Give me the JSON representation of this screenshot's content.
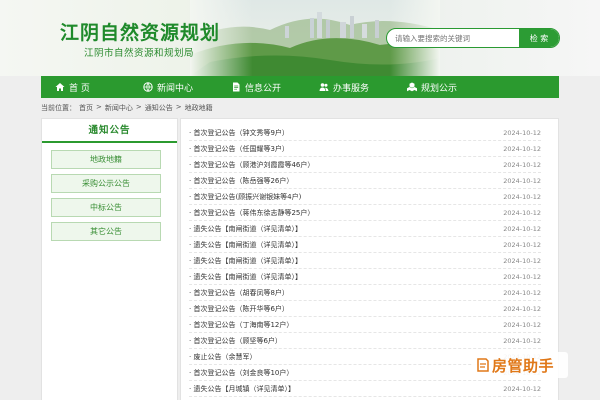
{
  "header": {
    "title": "江阴自然资源规划",
    "subtitle": "江阴市自然资源和规划局",
    "search_placeholder": "请输入要搜索的关键词",
    "search_button": "检 索"
  },
  "nav": [
    {
      "label": "首 页",
      "icon": "home-icon"
    },
    {
      "label": "新闻中心",
      "icon": "globe-icon"
    },
    {
      "label": "信息公开",
      "icon": "document-icon"
    },
    {
      "label": "办事服务",
      "icon": "people-icon"
    },
    {
      "label": "规划公示",
      "icon": "cubes-icon"
    }
  ],
  "breadcrumb": [
    "当前位置：",
    "首页",
    ">",
    "新闻中心",
    ">",
    "通知公告",
    ">",
    "地政地籍"
  ],
  "sidebar": {
    "title": "通知公告",
    "items": [
      "地政地籍",
      "采购公示公告",
      "中标公告",
      "其它公告"
    ]
  },
  "list": [
    {
      "title": "· 首次登记公告（钟文秀等9户）",
      "date": "2024-10-12"
    },
    {
      "title": "· 首次登记公告（任国耀等3户）",
      "date": "2024-10-12"
    },
    {
      "title": "· 首次登记公告（顾港沪刘霞霞等46户）",
      "date": "2024-10-12"
    },
    {
      "title": "· 首次登记公告（陈岳强等26户）",
      "date": "2024-10-12"
    },
    {
      "title": "· 首次登记公告(顾振兴谢银妹等4户)",
      "date": "2024-10-12"
    },
    {
      "title": "· 首次登记公告（蒋伟东徐志静等25户）",
      "date": "2024-10-12"
    },
    {
      "title": "· 遗失公告【南闸街道（详见清单）】",
      "date": "2024-10-12"
    },
    {
      "title": "· 遗失公告【南闸街道（详见清单）】",
      "date": "2024-10-12"
    },
    {
      "title": "· 遗失公告【南闸街道（详见清单）】",
      "date": "2024-10-12"
    },
    {
      "title": "· 遗失公告【南闸街道（详见清单）】",
      "date": "2024-10-12"
    },
    {
      "title": "· 首次登记公告（胡春凤等8户）",
      "date": "2024-10-12"
    },
    {
      "title": "· 首次登记公告（陈开华等6户）",
      "date": "2024-10-12"
    },
    {
      "title": "· 首次登记公告（丁海南等12户）",
      "date": "2024-10-12"
    },
    {
      "title": "· 首次登记公告（顾坚等6户）",
      "date": "2024-10-12"
    },
    {
      "title": "· 废止公告（余慧军）",
      "date": "2024-10-12"
    },
    {
      "title": "· 首次登记公告（刘金良等10户）",
      "date": "2024-10-12"
    },
    {
      "title": "· 遗失公告【月城镇（详见清单）】",
      "date": "2024-10-12"
    }
  ],
  "watermark": "房管助手",
  "colors": {
    "primary": "#2b9a2f",
    "title": "#1f8a2b",
    "watermark": "#e07818"
  }
}
